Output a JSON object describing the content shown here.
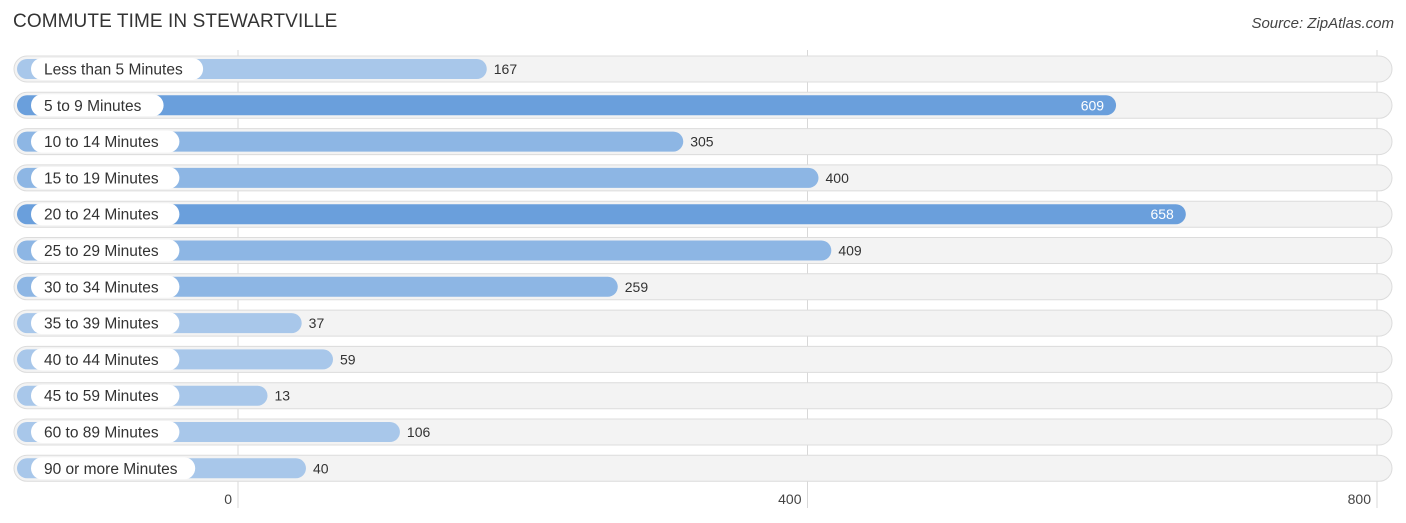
{
  "chart_data": {
    "type": "bar",
    "orientation": "horizontal",
    "title": "COMMUTE TIME IN STEWARTVILLE",
    "source": "Source: ZipAtlas.com",
    "categories": [
      "Less than 5 Minutes",
      "5 to 9 Minutes",
      "10 to 14 Minutes",
      "15 to 19 Minutes",
      "20 to 24 Minutes",
      "25 to 29 Minutes",
      "30 to 34 Minutes",
      "35 to 39 Minutes",
      "40 to 44 Minutes",
      "45 to 59 Minutes",
      "60 to 89 Minutes",
      "90 or more Minutes"
    ],
    "values": [
      167,
      609,
      305,
      400,
      658,
      409,
      259,
      37,
      59,
      13,
      106,
      40
    ],
    "xlabel": "",
    "ylabel": "",
    "xlim": [
      0,
      800
    ],
    "xticks": [
      0,
      400,
      800
    ],
    "xtick_labels": [
      "0",
      "400",
      "800"
    ],
    "grid": true,
    "colors": {
      "bar_high": "#6a9fdc",
      "bar_low": "#a8c7ea",
      "row_bg": "#f3f3f3",
      "label_bg": "#ffffff"
    },
    "value_label_inside_threshold": 600
  }
}
